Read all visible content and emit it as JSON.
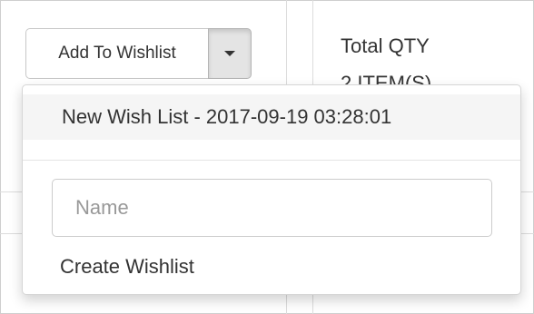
{
  "wishlist_button": {
    "label": "Add To Wishlist",
    "caret_icon": "caret-down-icon"
  },
  "cart_summary": {
    "total_qty_label": "Total QTY",
    "total_qty_value": "2 ITEM(S)"
  },
  "dropdown": {
    "wishlist_item": "New Wish List - 2017-09-19 03:28:01",
    "name_input": {
      "placeholder": "Name",
      "value": ""
    },
    "create_label": "Create Wishlist"
  },
  "colors": {
    "border": "#cccccc",
    "hover_bg": "#f5f5f5",
    "caret_bg": "#e4e4e4",
    "text": "#333333",
    "placeholder": "#999999"
  }
}
